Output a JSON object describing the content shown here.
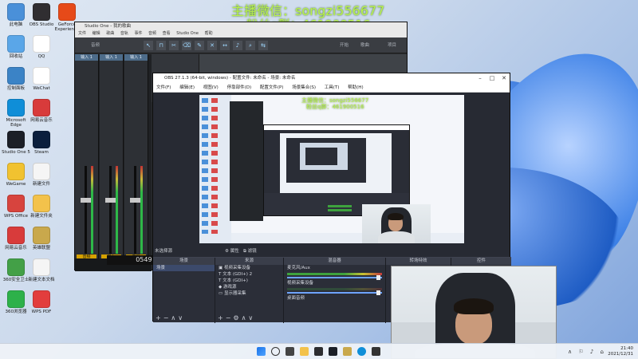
{
  "overlay": {
    "line1": "主播微信：songzi556677",
    "line2": "粉丝q群：461900516"
  },
  "desktop_icons": [
    {
      "label": "此电脑",
      "color": "#4a90d9"
    },
    {
      "label": "OBS Studio",
      "color": "#302e31"
    },
    {
      "label": "GeForce Experience",
      "color": "#e64a19"
    },
    {
      "label": "回收站",
      "color": "#5aa6e8"
    },
    {
      "label": "QQ",
      "color": "#ffffff"
    },
    {
      "label": "控制面板",
      "color": "#3b83c6"
    },
    {
      "label": "WeChat",
      "color": "#ffffff"
    },
    {
      "label": "Microsoft Edge",
      "color": "#0f8ed8"
    },
    {
      "label": "网易云音乐",
      "color": "#d83b3b"
    },
    {
      "label": "Studio One 5",
      "color": "#1b1f27"
    },
    {
      "label": "Steam",
      "color": "#0b1f3d"
    },
    {
      "label": "WeGame",
      "color": "#f1c230"
    },
    {
      "label": "新建文件",
      "color": "#f5f5f5"
    },
    {
      "label": "WPS Office",
      "color": "#d7443e"
    },
    {
      "label": "新建文件夹",
      "color": "#f3c24b"
    },
    {
      "label": "网易云音乐",
      "color": "#d83b3b"
    },
    {
      "label": "英雄联盟",
      "color": "#c9a84c"
    },
    {
      "label": "360安全卫士",
      "color": "#43a047"
    },
    {
      "label": "新建文本文档",
      "color": "#f5f5f5"
    },
    {
      "label": "360浏览器",
      "color": "#2db14a"
    },
    {
      "label": "WPS PDF",
      "color": "#e23d3d"
    }
  ],
  "studio": {
    "title": "Studio One - 我的歌曲",
    "menu": [
      "文件",
      "编辑",
      "歌曲",
      "音轨",
      "事件",
      "音频",
      "查看",
      "Studio One",
      "帮助"
    ],
    "toolbar": {
      "left": "音频",
      "start": "开始",
      "song": "歌曲",
      "project": "项目"
    },
    "timecode": "05499.03.0",
    "channels": [
      {
        "name": "输入 1",
        "label": "音频"
      },
      {
        "name": "输入 1",
        "label": "输入"
      },
      {
        "name": "输入 1",
        "label": "音频"
      }
    ]
  },
  "obs": {
    "title": "OBS 27.1.3 (64-bit, windows) - 配置文件: 未命名 - 场景: 未命名",
    "menu": [
      "文件(F)",
      "编辑(E)",
      "视图(V)",
      "停靠部件(D)",
      "配置文件(P)",
      "场景集合(S)",
      "工具(T)",
      "帮助(H)"
    ],
    "no_source": "未选择源",
    "props": "属性",
    "filters": "滤镜",
    "docks": {
      "scenes": {
        "header": "场景",
        "items": [
          "场景"
        ]
      },
      "sources": {
        "header": "来源",
        "items": [
          "视频采集设备",
          "文本 (GDI+) 2",
          "文本 (GDI+)",
          "游戏源",
          "显示器采集"
        ]
      },
      "mixer": {
        "header": "混音器",
        "items": [
          "麦克风/Aux",
          "视频采集设备",
          "桌面音频"
        ]
      },
      "transitions": {
        "header": "转场特效"
      },
      "controls": {
        "header": "控件"
      }
    }
  },
  "taskbar": {
    "time": "21:40",
    "date": "2021/12/31"
  }
}
